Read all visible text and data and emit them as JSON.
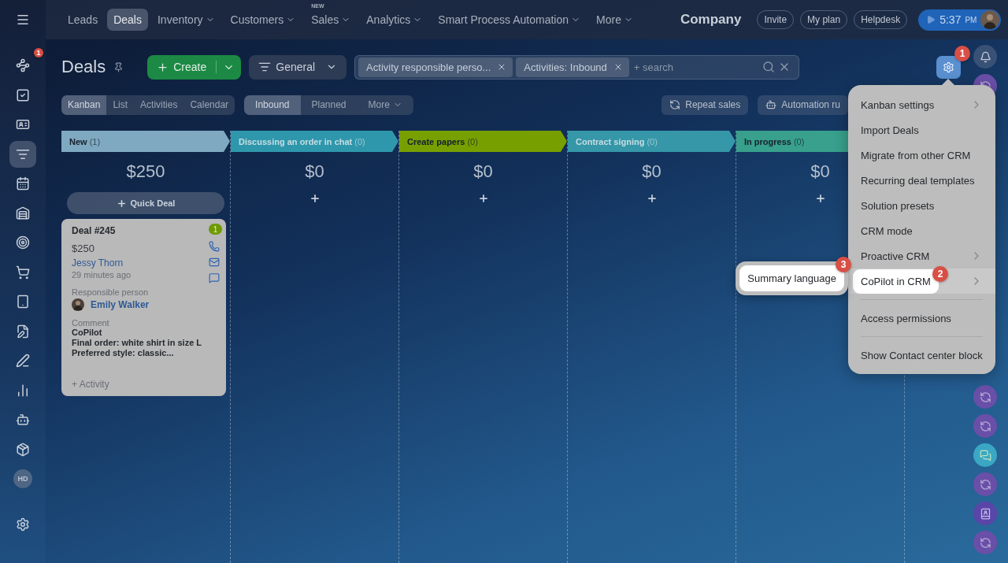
{
  "sidebar": {
    "items": [
      {
        "kind": "route",
        "selected": false,
        "badge": "1"
      },
      {
        "kind": "tasks",
        "selected": false
      },
      {
        "kind": "contacts",
        "selected": false
      },
      {
        "kind": "funnel",
        "selected": true
      },
      {
        "kind": "calendar",
        "selected": false
      },
      {
        "kind": "warehouse",
        "selected": false
      },
      {
        "kind": "target",
        "selected": false
      },
      {
        "kind": "cart",
        "selected": false
      },
      {
        "kind": "device",
        "selected": false
      },
      {
        "kind": "document",
        "selected": false
      },
      {
        "kind": "pen",
        "selected": false
      },
      {
        "kind": "chart",
        "selected": false
      },
      {
        "kind": "robot",
        "selected": false
      },
      {
        "kind": "box",
        "selected": false
      },
      {
        "kind": "initials",
        "label": "HD",
        "selected": false
      }
    ],
    "settings": {
      "kind": "settings"
    }
  },
  "top_nav": {
    "items": [
      {
        "label": "Leads",
        "selected": false,
        "dropdown": false
      },
      {
        "label": "Deals",
        "selected": true,
        "dropdown": false
      },
      {
        "label": "Inventory",
        "selected": false,
        "dropdown": true
      },
      {
        "label": "Customers",
        "selected": false,
        "dropdown": true
      },
      {
        "label": "Sales",
        "selected": false,
        "dropdown": true,
        "tag": "NEW"
      },
      {
        "label": "Analytics",
        "selected": false,
        "dropdown": true
      },
      {
        "label": "Smart Process Automation",
        "selected": false,
        "dropdown": true
      },
      {
        "label": "More",
        "selected": false,
        "dropdown": true
      }
    ],
    "company": "Company",
    "buttons": [
      "Invite",
      "My plan",
      "Helpdesk"
    ],
    "time": "5:37",
    "meridiem": "PM"
  },
  "header": {
    "title": "Deals",
    "create": "Create",
    "category": "General",
    "filters": [
      "Activity responsible perso...",
      "Activities: Inbound"
    ],
    "search": {
      "placeholder": "+ search"
    },
    "settings_badge": "1"
  },
  "views": [
    {
      "label": "Kanban",
      "selected": true
    },
    {
      "label": "List",
      "selected": false
    },
    {
      "label": "Activities",
      "selected": false
    },
    {
      "label": "Calendar",
      "selected": false
    }
  ],
  "activity_filters": [
    {
      "label": "Inbound",
      "selected": true
    },
    {
      "label": "Planned",
      "selected": false
    },
    {
      "label": "More",
      "selected": false,
      "dropdown": true
    }
  ],
  "tools": [
    {
      "kind": "repeat",
      "label": "Repeat sales"
    },
    {
      "kind": "robot",
      "label": "Automation ru"
    }
  ],
  "columns": [
    {
      "title": "New",
      "count": "(1)",
      "color": "#7fa9c0",
      "total": "$250",
      "quick_deal": "Quick Deal"
    },
    {
      "title": "Discussing an order in chat",
      "count": "(0)",
      "color": "#2f97ac",
      "total": "$0"
    },
    {
      "title": "Create papers",
      "count": "(0)",
      "color": "#789f00",
      "total": "$0"
    },
    {
      "title": "Contract signing",
      "count": "(0)",
      "color": "#3597a8",
      "total": "$0"
    },
    {
      "title": "In progress",
      "count": "(0)",
      "color": "#38a08c",
      "total": "$0"
    }
  ],
  "card": {
    "title": "Deal #245",
    "badge": "1",
    "amount": "$250",
    "contact": "Jessy Thorn",
    "time": "29 minutes ago",
    "responsible_label": "Responsible person",
    "responsible": "Emily Walker",
    "comment_label": "Comment",
    "comment": [
      "CoPilot",
      "Final order: white shirt in size L",
      "Preferred style: classic..."
    ],
    "activity": "+ Activity"
  },
  "menu": {
    "items": [
      {
        "kind": "item",
        "label": "Kanban settings",
        "submenu": true
      },
      {
        "kind": "item",
        "label": "Import Deals",
        "submenu": false
      },
      {
        "kind": "item",
        "label": "Migrate from other CRM",
        "submenu": false
      },
      {
        "kind": "item",
        "label": "Recurring deal templates",
        "submenu": false
      },
      {
        "kind": "item",
        "label": "Solution presets",
        "submenu": false
      },
      {
        "kind": "item",
        "label": "CRM mode",
        "submenu": false
      },
      {
        "kind": "item",
        "label": "Proactive CRM",
        "submenu": true
      },
      {
        "kind": "item",
        "label": "CoPilot in CRM",
        "submenu": true,
        "highlighted": true,
        "step": "2",
        "open": {
          "label": "Summary language",
          "step": "3"
        }
      },
      {
        "kind": "divider"
      },
      {
        "kind": "item",
        "label": "Access permissions",
        "submenu": false
      },
      {
        "kind": "divider"
      },
      {
        "kind": "item",
        "label": "Show Contact center block",
        "submenu": false
      }
    ]
  },
  "right_rail": {
    "top": [
      {
        "kind": "bell"
      },
      {
        "kind": "copilot"
      }
    ],
    "bottom": [
      {
        "kind": "copilot"
      },
      {
        "kind": "copilot"
      },
      {
        "kind": "chat"
      },
      {
        "kind": "copilot"
      },
      {
        "kind": "contact"
      },
      {
        "kind": "copilot"
      }
    ]
  }
}
